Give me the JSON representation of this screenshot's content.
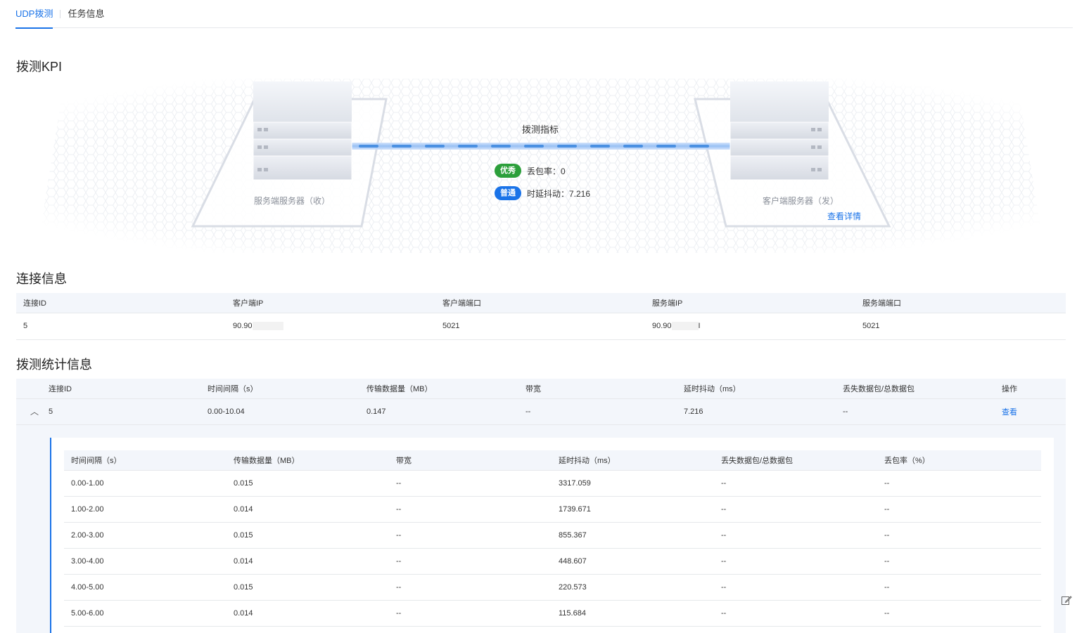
{
  "tabs": [
    {
      "label": "UDP拨测",
      "active": true
    },
    {
      "label": "任务信息",
      "active": false
    }
  ],
  "kpi": {
    "section_title": "拨测KPI",
    "server_recv_label": "服务端服务器（收）",
    "client_send_label": "客户端服务器（发）",
    "metric_title": "拨测指标",
    "metrics": [
      {
        "badge": "优秀",
        "text": "丢包率：0"
      },
      {
        "badge": "普通",
        "text": "时延抖动：7.216"
      }
    ],
    "detail_link": "查看详情"
  },
  "connection": {
    "section_title": "连接信息",
    "columns": [
      "连接ID",
      "客户端IP",
      "客户端端口",
      "服务端IP",
      "服务端端口"
    ],
    "rows": [
      {
        "id": "5",
        "client_ip": "90.90",
        "client_port": "5021",
        "server_ip": "90.90",
        "server_ip_suffix": "I",
        "server_port": "5021"
      }
    ]
  },
  "stats": {
    "section_title": "拨测统计信息",
    "columns": [
      "连接ID",
      "时间间隔（s）",
      "传输数据量（MB）",
      "带宽",
      "延时抖动（ms）",
      "丢失数据包/总数据包",
      "操作"
    ],
    "rows": [
      {
        "id": "5",
        "interval": "0.00-10.04",
        "transfer": "0.147",
        "bandwidth": "--",
        "jitter": "7.216",
        "lost": "--",
        "action": "查看"
      }
    ],
    "detail": {
      "columns": [
        "时间间隔（s）",
        "传输数据量（MB）",
        "带宽",
        "延时抖动（ms）",
        "丢失数据包/总数据包",
        "丢包率（%）"
      ],
      "rows": [
        [
          "0.00-1.00",
          "0.015",
          "--",
          "3317.059",
          "--",
          "--"
        ],
        [
          "1.00-2.00",
          "0.014",
          "--",
          "1739.671",
          "--",
          "--"
        ],
        [
          "2.00-3.00",
          "0.015",
          "--",
          "855.367",
          "--",
          "--"
        ],
        [
          "3.00-4.00",
          "0.014",
          "--",
          "448.607",
          "--",
          "--"
        ],
        [
          "4.00-5.00",
          "0.015",
          "--",
          "220.573",
          "--",
          "--"
        ],
        [
          "5.00-6.00",
          "0.014",
          "--",
          "115.684",
          "--",
          "--"
        ]
      ]
    }
  },
  "colors": {
    "accent": "#1a73e8",
    "good": "#2c9f3b",
    "header_bg": "#f3f6fb"
  }
}
